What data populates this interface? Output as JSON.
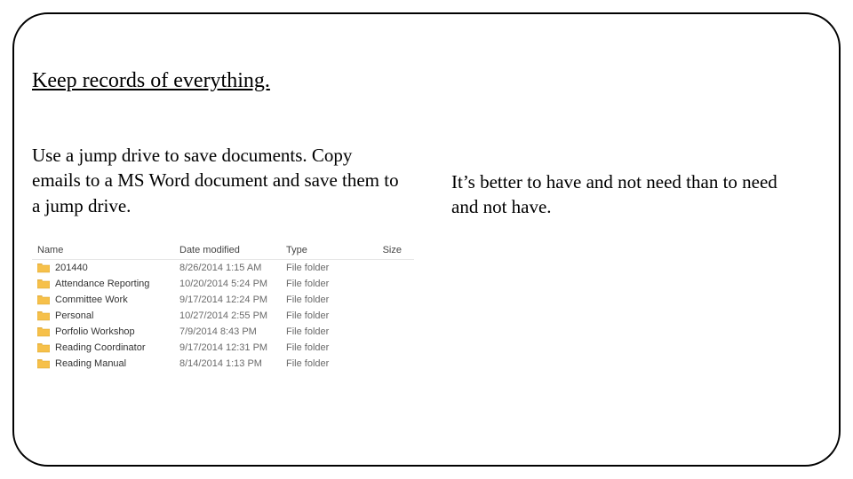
{
  "title": "Keep records of everything.",
  "left_text": "Use a jump drive to save documents. Copy emails to a MS Word document and save them to a jump drive.",
  "right_text": "It’s better to have and not need than to need and not have.",
  "file_list": {
    "headers": {
      "name": "Name",
      "date": "Date modified",
      "type": "Type",
      "size": "Size"
    },
    "rows": [
      {
        "name": "201440",
        "date": "8/26/2014 1:15 AM",
        "type": "File folder"
      },
      {
        "name": "Attendance Reporting",
        "date": "10/20/2014 5:24 PM",
        "type": "File folder"
      },
      {
        "name": "Committee Work",
        "date": "9/17/2014 12:24 PM",
        "type": "File folder"
      },
      {
        "name": "Personal",
        "date": "10/27/2014 2:55 PM",
        "type": "File folder"
      },
      {
        "name": "Porfolio Workshop",
        "date": "7/9/2014 8:43 PM",
        "type": "File folder"
      },
      {
        "name": "Reading Coordinator",
        "date": "9/17/2014 12:31 PM",
        "type": "File folder"
      },
      {
        "name": "Reading Manual",
        "date": "8/14/2014 1:13 PM",
        "type": "File folder"
      }
    ]
  }
}
